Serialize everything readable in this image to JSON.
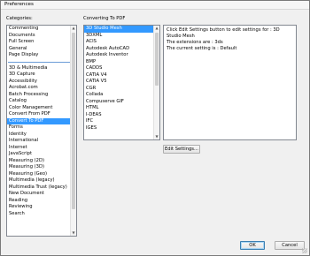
{
  "window": {
    "title": "Preferences"
  },
  "categories_label": "Categories:",
  "categories_top": [
    "Commenting",
    "Documents",
    "Full Screen",
    "General",
    "Page Display"
  ],
  "categories_main": [
    "3D & Multimedia",
    "3D Capture",
    "Accessibility",
    "Acrobat.com",
    "Batch Processing",
    "Catalog",
    "Color Management",
    "Convert From PDF",
    "Convert To PDF",
    "Forms",
    "Identity",
    "International",
    "Internet",
    "JavaScript",
    "Measuring (2D)",
    "Measuring (3D)",
    "Measuring (Geo)",
    "Multimedia (legacy)",
    "Multimedia Trust (legacy)",
    "New Document",
    "Reading",
    "Reviewing",
    "Search"
  ],
  "selected_category": "Convert To PDF",
  "section_title": "Converting To PDF",
  "formats": [
    "3D Studio Mesh",
    "3DXML",
    "ACIS",
    "Autodesk AutoCAD",
    "Autodesk Inventor",
    "BMP",
    "CADDS",
    "CATIA V4",
    "CATIA V5",
    "CGR",
    "Collada",
    "Compuserve GIF",
    "HTML",
    "I-DEAS",
    "IFC",
    "IGES"
  ],
  "selected_format": "3D Studio Mesh",
  "info": {
    "line1": "Click Edit Settings button to edit settings for : 3D Studio Mesh",
    "line2": "The extensions are : 3ds",
    "line3": "The current setting is : Default"
  },
  "buttons": {
    "edit_settings": "Edit Settings...",
    "ok": "OK",
    "cancel": "Cancel"
  }
}
